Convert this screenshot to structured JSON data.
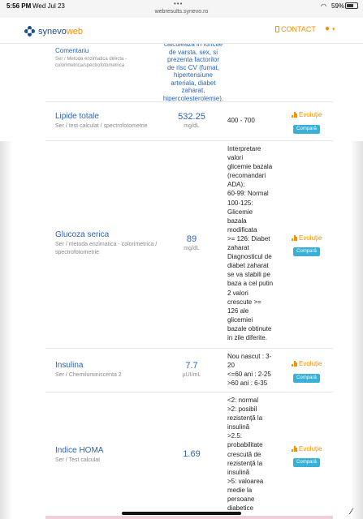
{
  "status_bar": {
    "time": "5:56 PM",
    "date": "Wed Jul 23",
    "dots": "•••",
    "url": "webresults.synevo.ro",
    "battery": "59%"
  },
  "navbar": {
    "logo_a": "synevo",
    "logo_b": "web",
    "contact": "CONTACT",
    "user_caret": "▾"
  },
  "comment_row": {
    "title": "Comentariu",
    "method": "Ser / Metoda enzimatica directa - colorimetrica/spectrofotometrica",
    "text": "calculeaza in functie\nde varsta, sex, si\nprezenta factorilor\nde risc CV (fumat,\nhipertensiune\narteriala, diabet\nzaharat,\nhipercolesterolemie)."
  },
  "rows": [
    {
      "name": "Lipide totale",
      "method": "Ser / test calculat / spectrofotometrie",
      "value": "532.25",
      "unit": "mg/dL",
      "ref": "400 - 700",
      "evol": "Evoluție",
      "cmp": "Compară"
    },
    {
      "name": "Glucoza serica",
      "method": "Ser / metoda enzimatica - colorimetrica / spectrofotometrie",
      "value": "89",
      "unit": "mg/dL",
      "ref": "Interpretare\nvalori\nglicemie bazala\n(recomandari\nADA):\n60-99: Normal\n100-125:\nGlicemie\nbazala\nmodificata\n>= 126: Diabet\nzaharat\nDiagnosticul de\ndiabet zaharat\nse va stabili pe\nbaza a cel putin\n2 valori\ncrescute >=\n126 ale\nglicemiei\nbazale obtinute\nin zile diferite.",
      "evol": "Evoluție",
      "cmp": "Compară"
    },
    {
      "name": "Insulina",
      "method": "Ser / Chemiluminiscenta 2",
      "value": "7.7",
      "unit": "µUI/mL",
      "ref": "Nou nascut : 3-\n20\n<=60 ani : 2-25\n>60 ani : 6-35",
      "evol": "Evoluție",
      "cmp": "Compară"
    },
    {
      "name": "Indice HOMA",
      "method": "Ser / Test calculat",
      "value": "1.69",
      "unit": "",
      "ref": "<2: normal\n>2: posibil\nrezistență la\ninsulină\n>2.5:\nprobabilitate\ncrescută de\nrezistență la\ninsulină\n>5: valoarea\nmedie la\npersoane\ndiabetice",
      "evol": "Evoluție",
      "cmp": "Compară"
    }
  ],
  "colors": {
    "brand_blue": "#1c4d8c",
    "brand_orange": "#f39200",
    "link_blue": "#2a64b6",
    "button_cyan": "#39b0d8"
  }
}
